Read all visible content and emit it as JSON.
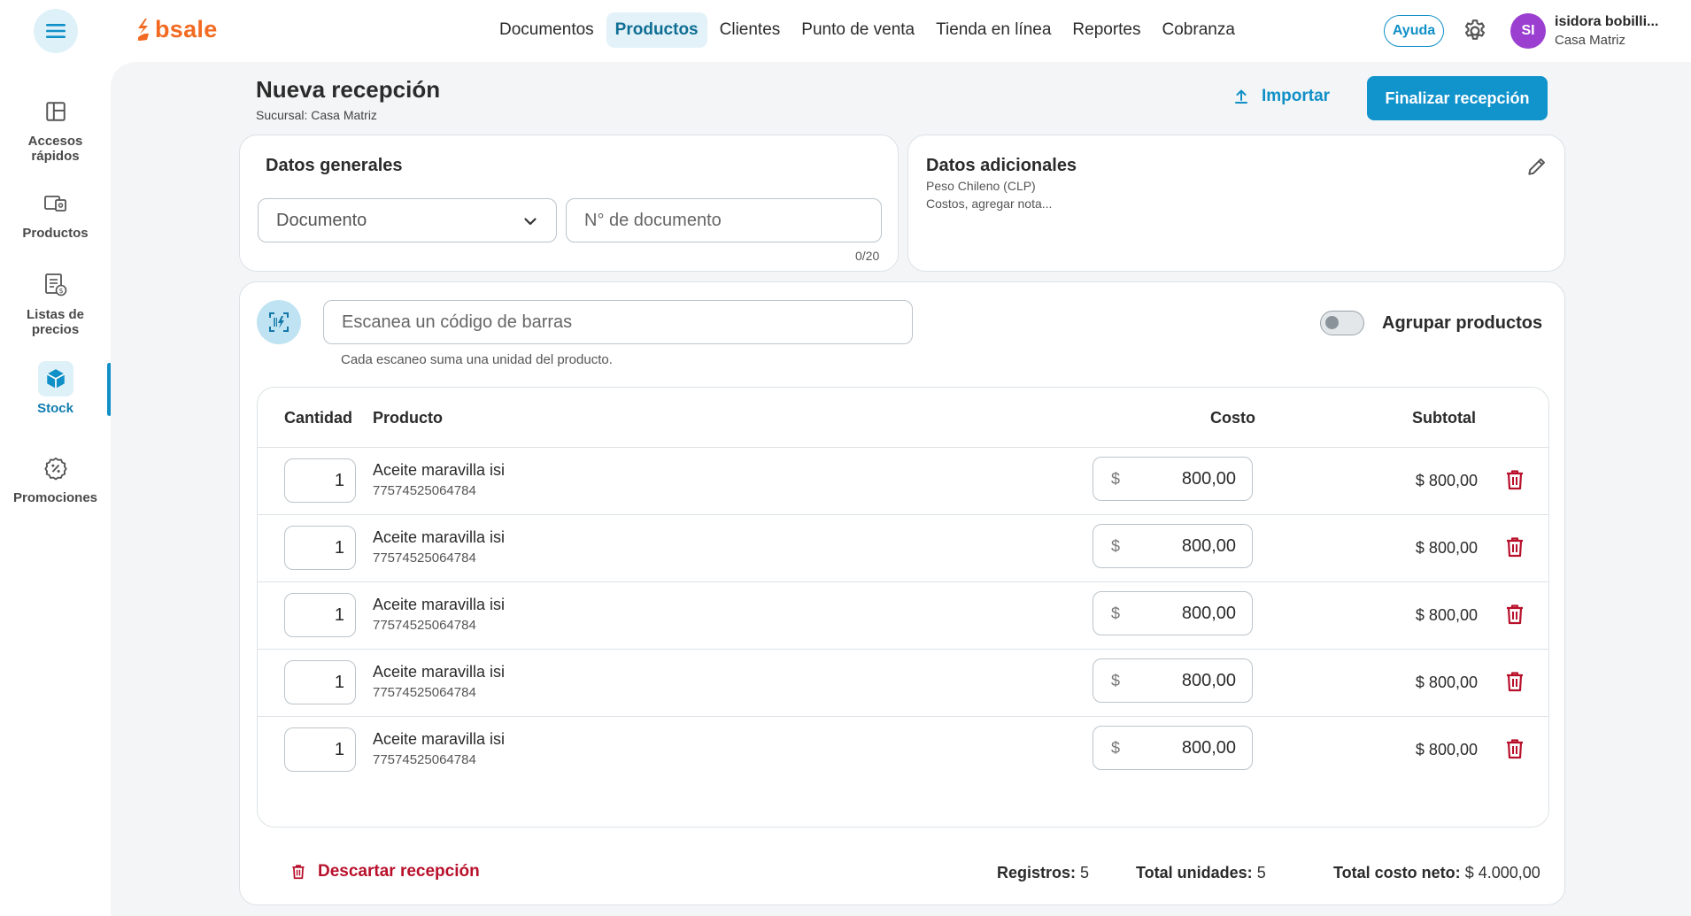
{
  "brand": {
    "name": "bsale",
    "color": "#f26a21"
  },
  "nav": {
    "items": [
      {
        "label": "Documentos",
        "active": false
      },
      {
        "label": "Productos",
        "active": true
      },
      {
        "label": "Clientes",
        "active": false
      },
      {
        "label": "Punto de venta",
        "active": false
      },
      {
        "label": "Tienda en línea",
        "active": false
      },
      {
        "label": "Reportes",
        "active": false
      },
      {
        "label": "Cobranza",
        "active": false
      }
    ]
  },
  "header": {
    "help_label": "Ayuda",
    "avatar_initials": "SI",
    "user_name": "isidora bobilli...",
    "user_branch": "Casa Matriz"
  },
  "sidebar": {
    "items": [
      {
        "label": "Accesos rápidos",
        "icon": "layout-icon"
      },
      {
        "label": "Productos",
        "icon": "products-icon"
      },
      {
        "label": "Listas de precios",
        "icon": "price-list-icon"
      },
      {
        "label": "Stock",
        "icon": "stock-cube-icon",
        "active": true
      },
      {
        "label": "Promociones",
        "icon": "promotion-badge-icon"
      }
    ]
  },
  "page": {
    "title": "Nueva recepción",
    "subtitle": "Sucursal: Casa Matriz",
    "import_label": "Importar",
    "finish_label": "Finalizar recepción"
  },
  "general": {
    "title": "Datos generales",
    "document_select": "Documento",
    "docnum_placeholder": "N° de documento",
    "counter": "0/20"
  },
  "additional": {
    "title": "Datos adicionales",
    "line1": "Peso Chileno (CLP)",
    "line2": "Costos, agregar nota..."
  },
  "scan": {
    "placeholder": "Escanea un código de barras",
    "help": "Cada escaneo suma una unidad del producto.",
    "group_label": "Agrupar productos",
    "group_enabled": false
  },
  "table": {
    "headers": {
      "qty": "Cantidad",
      "product": "Producto",
      "cost": "Costo",
      "subtotal": "Subtotal"
    },
    "currency": "$",
    "rows": [
      {
        "qty": "1",
        "name": "Aceite maravilla isi",
        "code": "77574525064784",
        "cost": "800,00",
        "subtotal": "$ 800,00"
      },
      {
        "qty": "1",
        "name": "Aceite maravilla isi",
        "code": "77574525064784",
        "cost": "800,00",
        "subtotal": "$ 800,00"
      },
      {
        "qty": "1",
        "name": "Aceite maravilla isi",
        "code": "77574525064784",
        "cost": "800,00",
        "subtotal": "$ 800,00"
      },
      {
        "qty": "1",
        "name": "Aceite maravilla isi",
        "code": "77574525064784",
        "cost": "800,00",
        "subtotal": "$ 800,00"
      },
      {
        "qty": "1",
        "name": "Aceite maravilla isi",
        "code": "77574525064784",
        "cost": "800,00",
        "subtotal": "$ 800,00"
      }
    ]
  },
  "footer": {
    "discard_label": "Descartar recepción",
    "records_label": "Registros:",
    "records_value": "5",
    "units_label": "Total unidades:",
    "units_value": "5",
    "total_label": "Total costo neto:",
    "total_value": "$ 4.000,00"
  },
  "colors": {
    "accent": "#1193cc",
    "danger": "#b8102b",
    "avatar": "#9b3fd0"
  }
}
